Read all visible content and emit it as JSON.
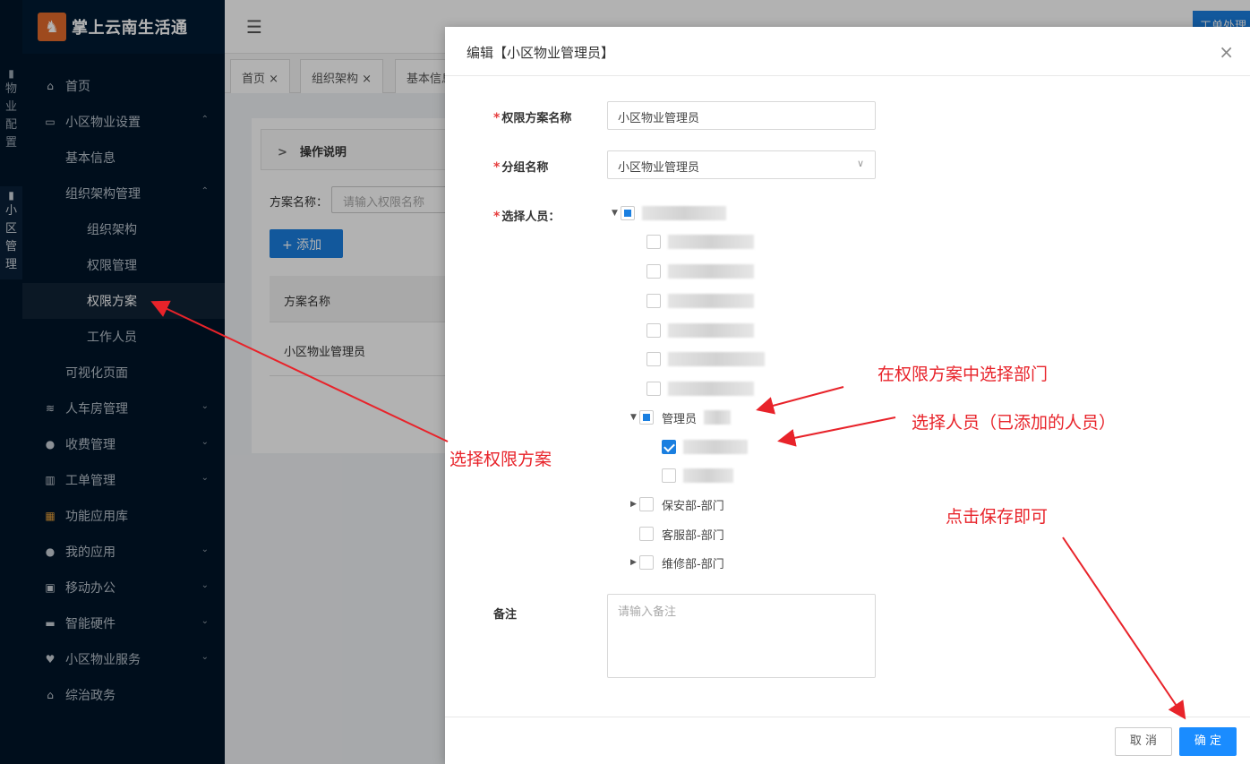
{
  "app": {
    "title": "掌上云南生活通",
    "logo_glyph": "♞"
  },
  "rail": {
    "group1": [
      "物",
      "业",
      "配",
      "置"
    ],
    "group2": [
      "小",
      "区",
      "管",
      "理"
    ]
  },
  "sidebar": {
    "items": [
      {
        "label": "首页",
        "icon": "home-icon",
        "glyph": "⌂"
      },
      {
        "label": "小区物业设置",
        "icon": "monitor-icon",
        "glyph": "▭",
        "arrow": "⌃"
      },
      {
        "label": "基本信息"
      },
      {
        "label": "组织架构管理",
        "arrow": "⌃"
      },
      {
        "label": "组织架构"
      },
      {
        "label": "权限管理"
      },
      {
        "label": "权限方案"
      },
      {
        "label": "工作人员"
      },
      {
        "label": "可视化页面"
      },
      {
        "label": "人车房管理",
        "icon": "database-icon",
        "glyph": "≋",
        "arrow": "⌄"
      },
      {
        "label": "收费管理",
        "icon": "money-bag-icon",
        "glyph": "●",
        "arrow": "⌄"
      },
      {
        "label": "工单管理",
        "icon": "columns-icon",
        "glyph": "▥",
        "arrow": "⌄"
      },
      {
        "label": "功能应用库",
        "icon": "app-grid-icon",
        "glyph": "▦"
      },
      {
        "label": "我的应用",
        "icon": "user-icon",
        "glyph": "●",
        "arrow": "⌄"
      },
      {
        "label": "移动办公",
        "icon": "briefcase-icon",
        "glyph": "▣",
        "arrow": "⌄"
      },
      {
        "label": "智能硬件",
        "icon": "hardware-icon",
        "glyph": "▬",
        "arrow": "⌄"
      },
      {
        "label": "小区物业服务",
        "icon": "hands-icon",
        "glyph": "♥",
        "arrow": "⌄"
      },
      {
        "label": "综治政务",
        "icon": "government-icon",
        "glyph": "⌂"
      }
    ]
  },
  "topbar": {
    "right_button": "工单处理"
  },
  "tabs": [
    "首页",
    "组织架构",
    "基本信息"
  ],
  "tab_close": "×",
  "background_page": {
    "op_title": "操作说明",
    "filter_label": "方案名称：",
    "filter_placeholder": "请输入权限名称",
    "add_button": "+ 添加",
    "table_header": "方案名称",
    "table_row": "小区物业管理员"
  },
  "modal": {
    "title": "编辑【小区物业管理员】",
    "close": "×",
    "required_mark": "*",
    "scheme_label": "权限方案名称",
    "scheme_value": "小区物业管理员",
    "group_label": "分组名称",
    "group_value": "小区物业管理员",
    "people_label": "选择人员：",
    "tree": {
      "admin_label": "管理员",
      "security_label": "保安部-部门",
      "service_label": "客服部-部门",
      "repair_label": "维修部-部门"
    },
    "remark_label": "备注",
    "remark_placeholder": "请输入备注",
    "cancel": "取 消",
    "ok": "确 定"
  },
  "annotations": {
    "select_scheme": "选择权限方案",
    "select_dept": "在权限方案中选择部门",
    "select_people": "选择人员（已添加的人员）",
    "click_save": "点击保存即可",
    "color": "#e8232a"
  }
}
